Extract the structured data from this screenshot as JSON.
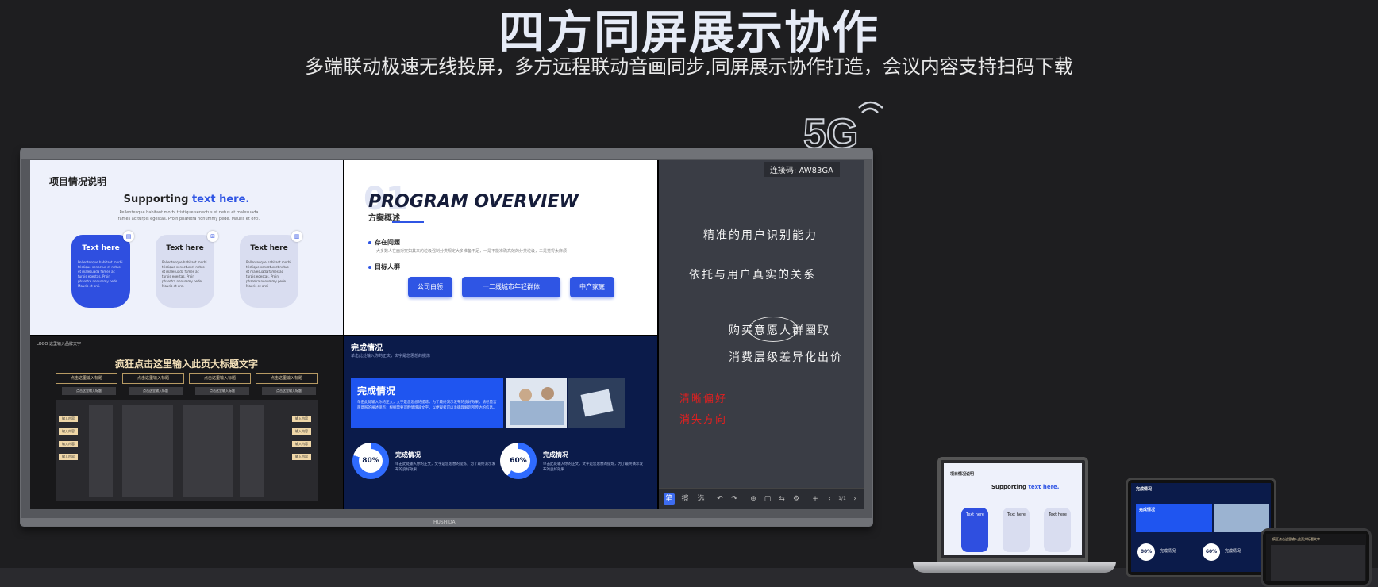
{
  "hero": {
    "title": "四方同屏展示协作",
    "subtitle": "多端联动极速无线投屏，多方远程联动音画同步,同屏展示协作打造，会议内容支持扫码下载",
    "badge": "5G"
  },
  "board": {
    "brand": "HUSHIDA",
    "panel1": {
      "heading": "项目情况说明",
      "supporting_a": "Supporting ",
      "supporting_b": "text here.",
      "desc": "Pellentesque habitant morbi tristique senectus et netus et malesuada fames ac turpis egestas. Proin pharetra nonummy pede. Mauris et orci.",
      "cards": [
        {
          "title": "Text here",
          "body": "Pellentesque habitant morbi tristique senectus et netus et malesuada fames ac turpis egestas. Proin pharetra nonummy pede. Mauris et orci."
        },
        {
          "title": "Text here",
          "body": "Pellentesque habitant morbi tristique senectus et netus et malesuada fames ac turpis egestas. Proin pharetra nonummy pede. Mauris et orci."
        },
        {
          "title": "Text here",
          "body": "Pellentesque habitant morbi tristique senectus et netus et malesuada fames ac turpis egestas. Proin pharetra nonummy pede. Mauris et orci."
        }
      ]
    },
    "panel2": {
      "bg_number": "01",
      "title": "PROGRAM OVERVIEW",
      "subtitle": "方案概述",
      "item1": "存在问题",
      "item1_desc": "大多数人在面对突如其来的垃圾强制分类规定大多准备不足，一是不能准确高效的分类垃圾，二是觉得太麻烦",
      "item2": "目标人群",
      "pills": [
        "公司白领",
        "一二线城市年轻群体",
        "中产家庭"
      ]
    },
    "panel3": {
      "logo": "LOGO 这里输入品牌文字",
      "title": "疯狂点击这里输入此页大标题文字",
      "header_cells": [
        "点击这里输入标题",
        "点击这里输入标题",
        "点击这里输入标题",
        "点击这里输入标题"
      ],
      "sub_cells": [
        "点击这里输入标题",
        "点击这里输入标题",
        "点击这里输入标题",
        "点击这里输入标题"
      ],
      "tag": "输入内容"
    },
    "panel4": {
      "title": "完成情况",
      "subtitle": "单击此处输入你的正文，文字是您思想的提炼",
      "box_title": "完成情况",
      "box_body": "单击此处输入你的正文，文字是您思想的提炼，为了最终演示发布的良好效果，请尽量言简意赅的阐述观点；根据需要可酌情增减文字，以便观者可以准确理解您所传达的信息。",
      "stat1": {
        "percent": "80%",
        "value": 0.8,
        "title": "完成情况",
        "body": "单击此处输入你的正文，文字是您思想的提炼，为了最终演示发布的良好效果"
      },
      "stat2": {
        "percent": "60%",
        "value": 0.6,
        "title": "完成情况",
        "body": "单击此处输入你的正文，文字是您思想的提炼，为了最终演示发布的良好效果"
      }
    },
    "panel5": {
      "code_label": "连接码:",
      "code_value": "AW83GA",
      "lines": [
        "精准的用户识别能力",
        "依托与用户真实的关系",
        "购买意愿人群圈取",
        "消费层级差异化出价"
      ],
      "red_lines": [
        "清晰偏好",
        "消失方向"
      ],
      "toolbar": [
        "笔",
        "擦",
        "选",
        "↶",
        "↷",
        "⊕",
        "▢",
        "⇆",
        "⚙",
        "+",
        "‹",
        "1/1",
        "›"
      ]
    }
  },
  "devices": {
    "laptop_heading": "项目情况说明",
    "laptop_sup_a": "Supporting ",
    "laptop_sup_b": "text here.",
    "laptop_card": "Text here",
    "tablet_title": "完成情况",
    "tablet_stat1": "80%",
    "tablet_stat2": "60%",
    "tablet_stat_title": "完成情况",
    "phone_title": "疯狂点击这里输入此页大标题文字"
  }
}
